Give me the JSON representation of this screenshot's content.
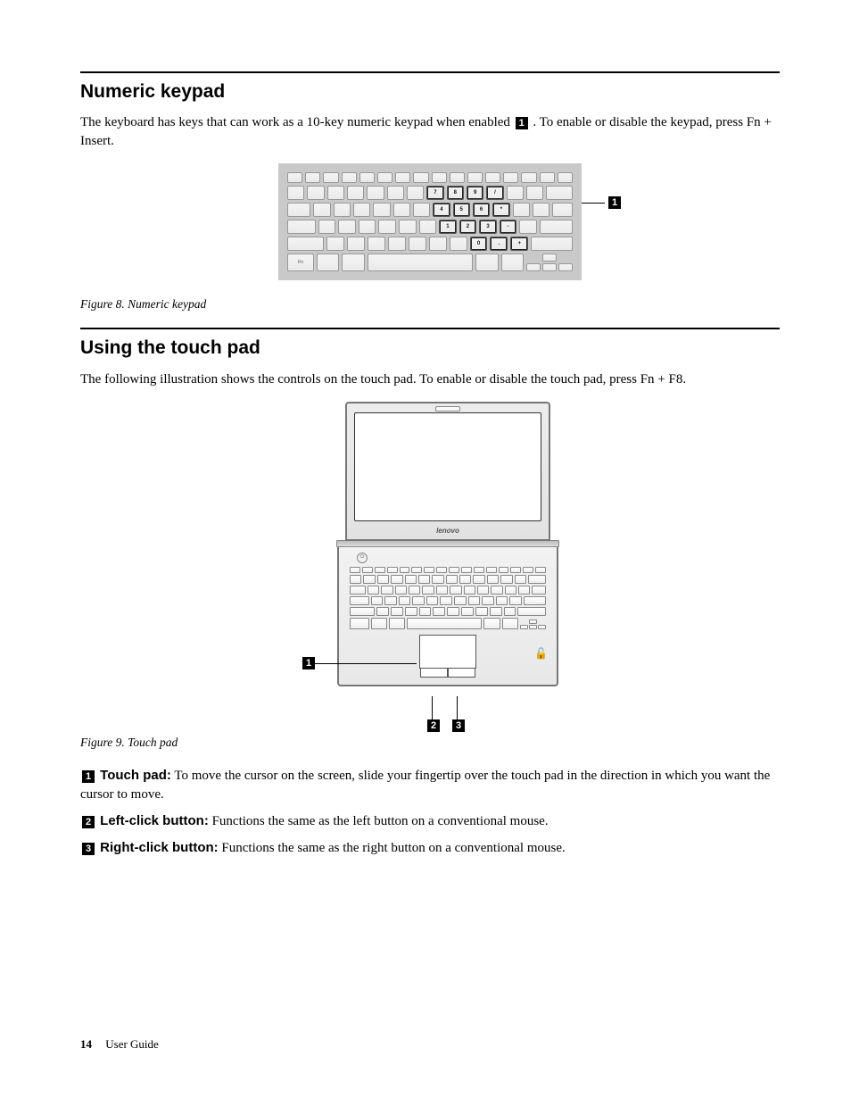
{
  "section1": {
    "heading": "Numeric keypad",
    "para_a": "The keyboard has keys that can work as a 10-key numeric keypad when enabled ",
    "para_b": ". To enable or disable the keypad, press Fn + Insert.",
    "callout": "1",
    "figcaption": "Figure 8. Numeric keypad",
    "numpad_labels": [
      "7",
      "8",
      "9",
      "/",
      "4",
      "5",
      "6",
      "*",
      "1",
      "2",
      "3",
      "-",
      "0",
      ".",
      "+"
    ],
    "brand": "lenovo"
  },
  "section2": {
    "heading": "Using the touch pad",
    "para": "The following illustration shows the controls on the touch pad. To enable or disable the touch pad, press Fn + F8.",
    "figcaption": "Figure 9. Touch pad",
    "callouts": {
      "c1": "1",
      "c2": "2",
      "c3": "3"
    }
  },
  "list": [
    {
      "num": "1",
      "label": "Touch pad:",
      "text": " To move the cursor on the screen, slide your fingertip over the touch pad in the direction in which you want the cursor to move."
    },
    {
      "num": "2",
      "label": "Left-click button:",
      "text": " Functions the same as the left button on a conventional mouse."
    },
    {
      "num": "3",
      "label": "Right-click button:",
      "text": " Functions the same as the right button on a conventional mouse."
    }
  ],
  "footer": {
    "page": "14",
    "title": "User Guide"
  }
}
